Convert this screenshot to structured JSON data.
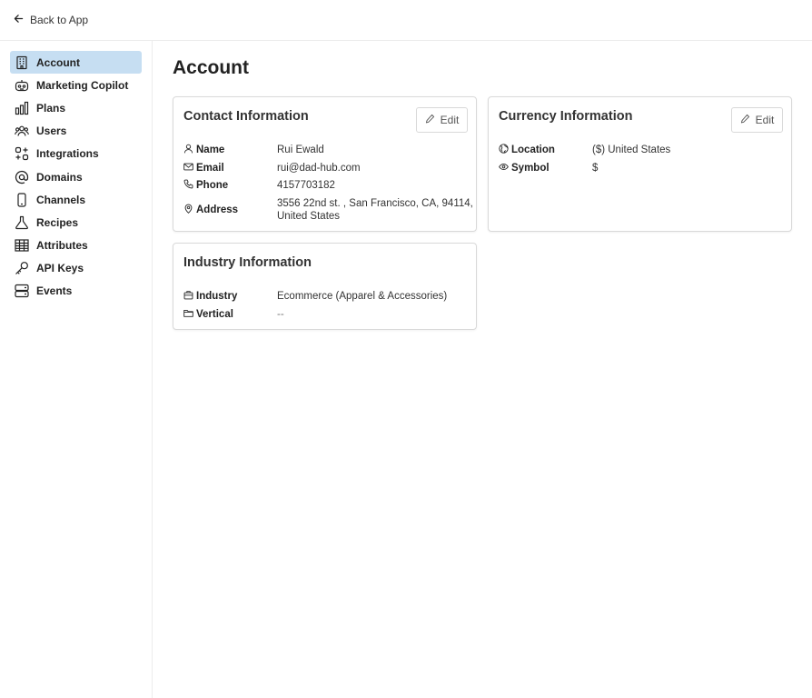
{
  "topbar": {
    "back_label": "Back to App"
  },
  "sidebar": {
    "items": [
      {
        "label": "Account",
        "icon": "building-icon",
        "active": true
      },
      {
        "label": "Marketing Copilot",
        "icon": "robot-icon"
      },
      {
        "label": "Plans",
        "icon": "bar-chart-icon"
      },
      {
        "label": "Users",
        "icon": "users-icon"
      },
      {
        "label": "Integrations",
        "icon": "integrations-icon"
      },
      {
        "label": "Domains",
        "icon": "at-icon"
      },
      {
        "label": "Channels",
        "icon": "phone-device-icon"
      },
      {
        "label": "Recipes",
        "icon": "flask-icon"
      },
      {
        "label": "Attributes",
        "icon": "table-icon"
      },
      {
        "label": "API Keys",
        "icon": "key-icon"
      },
      {
        "label": "Events",
        "icon": "events-icon"
      }
    ]
  },
  "page": {
    "title": "Account"
  },
  "contact": {
    "title": "Contact Information",
    "edit_label": "Edit",
    "rows": [
      {
        "label": "Name",
        "value": "Rui Ewald",
        "icon": "user-icon"
      },
      {
        "label": "Email",
        "value": "rui@dad-hub.com",
        "icon": "mail-icon"
      },
      {
        "label": "Phone",
        "value": "4157703182",
        "icon": "phone-icon"
      },
      {
        "label": "Address",
        "value": "3556 22nd st. , San Francisco, CA, 94114,",
        "value2": "United States",
        "icon": "map-pin-icon"
      }
    ]
  },
  "currency": {
    "title": "Currency Information",
    "edit_label": "Edit",
    "rows": [
      {
        "label": "Location",
        "value": "($) United States",
        "icon": "globe-icon"
      },
      {
        "label": "Symbol",
        "value": "$",
        "icon": "eye-icon"
      }
    ]
  },
  "industry": {
    "title": "Industry Information",
    "rows": [
      {
        "label": "Industry",
        "value": "Ecommerce (Apparel & Accessories)",
        "icon": "briefcase-icon"
      },
      {
        "label": "Vertical",
        "value": "--",
        "icon": "folder-icon"
      }
    ]
  },
  "colors": {
    "active_nav_bg": "#c6def2",
    "border": "#d9d9d9"
  }
}
